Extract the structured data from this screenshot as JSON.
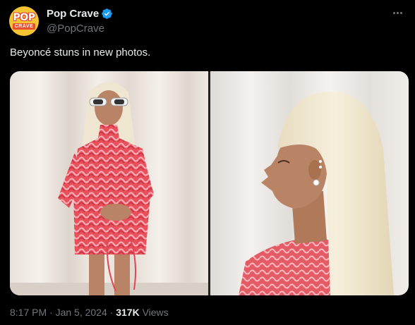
{
  "account": {
    "avatar_top": "POP",
    "avatar_bottom": "CRAVE",
    "display_name": "Pop Crave",
    "handle": "@PopCrave",
    "verified_icon": "verified-badge-icon"
  },
  "post": {
    "text": "Beyoncé stuns in new photos.",
    "time": "8:17 PM",
    "separator": " · ",
    "date": "Jan 5, 2024",
    "views_count": "317K",
    "views_label": " Views"
  },
  "colors": {
    "background": "#000000",
    "text_primary": "#e7e9ea",
    "text_secondary": "#71767b",
    "verified": "#1d9bf0",
    "avatar_bg": "#f5c432"
  },
  "media": {
    "photos": [
      {
        "subject": "full-length photo of woman in red patterned dress with white sunglasses"
      },
      {
        "subject": "profile close-up of woman with platinum blonde ponytail and earrings"
      }
    ]
  }
}
